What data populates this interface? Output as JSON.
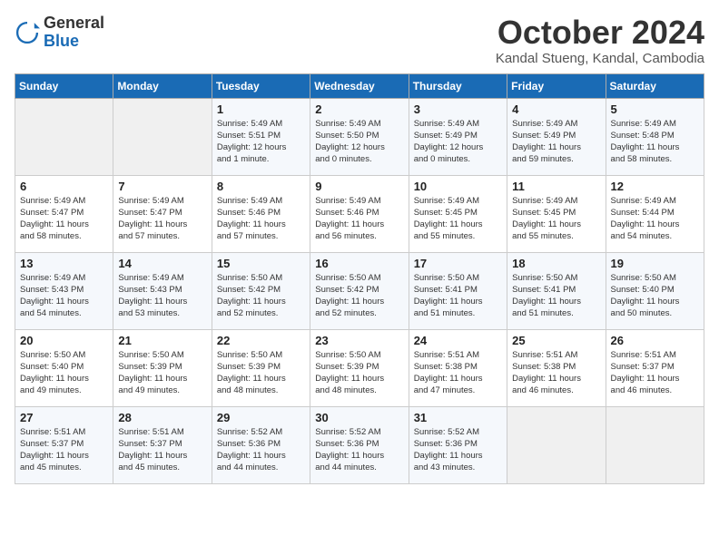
{
  "header": {
    "logo_general": "General",
    "logo_blue": "Blue",
    "month_title": "October 2024",
    "location": "Kandal Stueng, Kandal, Cambodia"
  },
  "weekdays": [
    "Sunday",
    "Monday",
    "Tuesday",
    "Wednesday",
    "Thursday",
    "Friday",
    "Saturday"
  ],
  "weeks": [
    [
      {
        "day": "",
        "detail": ""
      },
      {
        "day": "",
        "detail": ""
      },
      {
        "day": "1",
        "detail": "Sunrise: 5:49 AM\nSunset: 5:51 PM\nDaylight: 12 hours\nand 1 minute."
      },
      {
        "day": "2",
        "detail": "Sunrise: 5:49 AM\nSunset: 5:50 PM\nDaylight: 12 hours\nand 0 minutes."
      },
      {
        "day": "3",
        "detail": "Sunrise: 5:49 AM\nSunset: 5:49 PM\nDaylight: 12 hours\nand 0 minutes."
      },
      {
        "day": "4",
        "detail": "Sunrise: 5:49 AM\nSunset: 5:49 PM\nDaylight: 11 hours\nand 59 minutes."
      },
      {
        "day": "5",
        "detail": "Sunrise: 5:49 AM\nSunset: 5:48 PM\nDaylight: 11 hours\nand 58 minutes."
      }
    ],
    [
      {
        "day": "6",
        "detail": "Sunrise: 5:49 AM\nSunset: 5:47 PM\nDaylight: 11 hours\nand 58 minutes."
      },
      {
        "day": "7",
        "detail": "Sunrise: 5:49 AM\nSunset: 5:47 PM\nDaylight: 11 hours\nand 57 minutes."
      },
      {
        "day": "8",
        "detail": "Sunrise: 5:49 AM\nSunset: 5:46 PM\nDaylight: 11 hours\nand 57 minutes."
      },
      {
        "day": "9",
        "detail": "Sunrise: 5:49 AM\nSunset: 5:46 PM\nDaylight: 11 hours\nand 56 minutes."
      },
      {
        "day": "10",
        "detail": "Sunrise: 5:49 AM\nSunset: 5:45 PM\nDaylight: 11 hours\nand 55 minutes."
      },
      {
        "day": "11",
        "detail": "Sunrise: 5:49 AM\nSunset: 5:45 PM\nDaylight: 11 hours\nand 55 minutes."
      },
      {
        "day": "12",
        "detail": "Sunrise: 5:49 AM\nSunset: 5:44 PM\nDaylight: 11 hours\nand 54 minutes."
      }
    ],
    [
      {
        "day": "13",
        "detail": "Sunrise: 5:49 AM\nSunset: 5:43 PM\nDaylight: 11 hours\nand 54 minutes."
      },
      {
        "day": "14",
        "detail": "Sunrise: 5:49 AM\nSunset: 5:43 PM\nDaylight: 11 hours\nand 53 minutes."
      },
      {
        "day": "15",
        "detail": "Sunrise: 5:50 AM\nSunset: 5:42 PM\nDaylight: 11 hours\nand 52 minutes."
      },
      {
        "day": "16",
        "detail": "Sunrise: 5:50 AM\nSunset: 5:42 PM\nDaylight: 11 hours\nand 52 minutes."
      },
      {
        "day": "17",
        "detail": "Sunrise: 5:50 AM\nSunset: 5:41 PM\nDaylight: 11 hours\nand 51 minutes."
      },
      {
        "day": "18",
        "detail": "Sunrise: 5:50 AM\nSunset: 5:41 PM\nDaylight: 11 hours\nand 51 minutes."
      },
      {
        "day": "19",
        "detail": "Sunrise: 5:50 AM\nSunset: 5:40 PM\nDaylight: 11 hours\nand 50 minutes."
      }
    ],
    [
      {
        "day": "20",
        "detail": "Sunrise: 5:50 AM\nSunset: 5:40 PM\nDaylight: 11 hours\nand 49 minutes."
      },
      {
        "day": "21",
        "detail": "Sunrise: 5:50 AM\nSunset: 5:39 PM\nDaylight: 11 hours\nand 49 minutes."
      },
      {
        "day": "22",
        "detail": "Sunrise: 5:50 AM\nSunset: 5:39 PM\nDaylight: 11 hours\nand 48 minutes."
      },
      {
        "day": "23",
        "detail": "Sunrise: 5:50 AM\nSunset: 5:39 PM\nDaylight: 11 hours\nand 48 minutes."
      },
      {
        "day": "24",
        "detail": "Sunrise: 5:51 AM\nSunset: 5:38 PM\nDaylight: 11 hours\nand 47 minutes."
      },
      {
        "day": "25",
        "detail": "Sunrise: 5:51 AM\nSunset: 5:38 PM\nDaylight: 11 hours\nand 46 minutes."
      },
      {
        "day": "26",
        "detail": "Sunrise: 5:51 AM\nSunset: 5:37 PM\nDaylight: 11 hours\nand 46 minutes."
      }
    ],
    [
      {
        "day": "27",
        "detail": "Sunrise: 5:51 AM\nSunset: 5:37 PM\nDaylight: 11 hours\nand 45 minutes."
      },
      {
        "day": "28",
        "detail": "Sunrise: 5:51 AM\nSunset: 5:37 PM\nDaylight: 11 hours\nand 45 minutes."
      },
      {
        "day": "29",
        "detail": "Sunrise: 5:52 AM\nSunset: 5:36 PM\nDaylight: 11 hours\nand 44 minutes."
      },
      {
        "day": "30",
        "detail": "Sunrise: 5:52 AM\nSunset: 5:36 PM\nDaylight: 11 hours\nand 44 minutes."
      },
      {
        "day": "31",
        "detail": "Sunrise: 5:52 AM\nSunset: 5:36 PM\nDaylight: 11 hours\nand 43 minutes."
      },
      {
        "day": "",
        "detail": ""
      },
      {
        "day": "",
        "detail": ""
      }
    ]
  ]
}
